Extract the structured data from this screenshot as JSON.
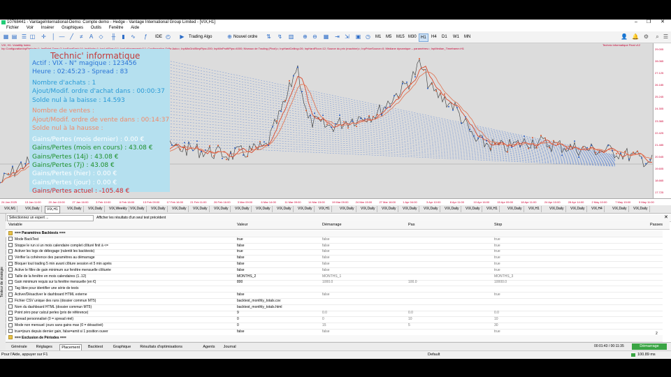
{
  "window": {
    "title": "10768441 - VantageInternational-Demo: Compte demo - Hedge - Vantage International Group Limited - [VIX,H1]",
    "minimize": "–",
    "restore": "❐",
    "close": "✕"
  },
  "menu": [
    "Fichier",
    "Voir",
    "Insérer",
    "Graphiques",
    "Outils",
    "Fenêtre",
    "Aide"
  ],
  "toolbar": {
    "ide": "IDE",
    "algo": "Trading Algo",
    "new_order": "Nouvel ordre",
    "timeframes": [
      "M1",
      "M5",
      "M15",
      "M30",
      "H1",
      "H4",
      "D1",
      "W1",
      "MN"
    ],
    "selected_tf": "H1"
  },
  "chart": {
    "symbol_line": "VIX, H1:  Volatility Index",
    "info_line": "Inp ConfigurationInpPeriode=1; InpPoint Zone=2; InpEmaFast=14; InpMode=1; InpLotSize=0.1; InpLotIncrement=0.1; Configuration Grille Auto=; InpMinGridStepPips=200; InpMinProfitPips=4000; Niveaux de Trading (Pivot)=; InpHardCeiling=26; InpHardFloor=12; Source du prix (machine)=; InpPriceSource=0; Médiane dynamique – paramètres=; InpMedian_Timeframe=H1",
    "right_label": "Technic informatique Final v12",
    "price_ticks": [
      "29.005",
      "28.065",
      "27.125",
      "26.185",
      "25.245",
      "24.305",
      "23.365",
      "22.425",
      "21.485",
      "20.545",
      "19.605",
      "18.665",
      "17.725"
    ],
    "date_ticks": [
      "24 Jan 2025",
      "13 Jan 11:00",
      "20 Jan 10:00",
      "27 Jan 16:00",
      "3 Feb 10:00",
      "6 Feb 16:00",
      "13 Feb 09:00",
      "17 Feb 16:00",
      "21 Feb 11:00",
      "26 Feb 16:00",
      "3 Mar 09:00",
      "6 Mar 14:00",
      "11 Mar 09:00",
      "14 Mar 15:00",
      "19 Mar 09:00",
      "24 Mar 15:00",
      "27 Mar 16:00",
      "1 Apr 04:00",
      "3 Apr 10:00",
      "8 Apr 11:00",
      "10 Apr 16:00",
      "15 Apr 09:00",
      "18 Apr 11:00",
      "24 Apr 10:00",
      "28 Apr 14:00",
      "2 May 10:00",
      "7 May 15:00",
      "9 May 11:00"
    ]
  },
  "panel": {
    "title": "Technic' informatique",
    "lines": [
      {
        "text": "Actif : VIX - N° magique : 123456",
        "color": "#2a74d6"
      },
      {
        "text": "Heure : 02:45:23 - Spread : 83",
        "color": "#2a74d6"
      },
      {
        "text": "Nombre d'achats : 1",
        "color": "#2a9ad6"
      },
      {
        "text": "Ajout/Modif. ordre d'achat dans : 00:00:37",
        "color": "#2a9ad6"
      },
      {
        "text": "Solde nul à la baisse : 14.593",
        "color": "#2a9ad6"
      },
      {
        "text": "Nombre de ventes :",
        "color": "#f08a6a"
      },
      {
        "text": "Ajout/Modif. ordre de vente dans : 00:14:37",
        "color": "#f08a6a"
      },
      {
        "text": "Solde nul à la hausse :",
        "color": "#f08a6a"
      },
      {
        "text": "Gains/Pertes (mois dernier) : 0.00 €",
        "color": "#ffffff"
      },
      {
        "text": "Gains/Pertes (mois en cours) : 43.08 €",
        "color": "#1d8f2a"
      },
      {
        "text": "Gains/Pertes (14j) : 43.08 €",
        "color": "#1d8f2a"
      },
      {
        "text": "Gains/Pertes (7j) : 43.08 €",
        "color": "#1d8f2a"
      },
      {
        "text": "Gains/Pertes (hier) : 0.00 €",
        "color": "#ffffff"
      },
      {
        "text": "Gains/Pertes (jour) : 0.00 €",
        "color": "#ffffff"
      },
      {
        "text": "Gains/Pertes actuel : -105.48 €",
        "color": "#d8262a"
      }
    ]
  },
  "chart_tabs": [
    "VIX,M1",
    "VIX,Daily",
    "VIX,H1",
    "VIX,Daily",
    "VIX,Daily",
    "VIX,Weekly",
    "VIX,Daily",
    "VIX,Daily",
    "VIX,Daily",
    "VIX,Daily",
    "VIX,Daily",
    "VIX,Daily",
    "VIX,Daily",
    "VIX,Daily",
    "VIX,Daily",
    "VIX,H1",
    "VIX,Daily",
    "VIX,Daily",
    "VIX,Daily",
    "VIX,Daily",
    "VIX,Daily",
    "VIX,Daily",
    "VIX,Daily",
    "VIX,H1",
    "VIX,Daily",
    "VIX,H1",
    "VIX,Daily",
    "VIX,Daily",
    "VIX,H4",
    "VIX,Daily",
    "VIX,Daily"
  ],
  "active_chart_tab": 2,
  "tester": {
    "select_expert": "Sélectionnez un expert ...",
    "show_results": "Afficher les résultats d'un seul test précédent",
    "side_label": "Testeur de stratégie",
    "headers": {
      "variable": "Variable",
      "valeur": "Valeur",
      "demarrage": "Démarrage",
      "pas": "Pas",
      "stop": "Stop",
      "passes": "Passes"
    },
    "rows": [
      {
        "name": "=== Paramètres Backtests ===",
        "section": true,
        "valeur": "",
        "demarrage": "",
        "pas": "",
        "stop": ""
      },
      {
        "name": "Mode BackTest",
        "valeur": "true",
        "demarrage": "false",
        "pas": "",
        "stop": "true"
      },
      {
        "name": "Stoppe le run si un mois calendaire complet clôturé finit à <=",
        "valeur": "false",
        "demarrage": "false",
        "pas": "",
        "stop": "true"
      },
      {
        "name": "Activer les logs de débogage (ralentit les backtests)",
        "valeur": "true",
        "demarrage": "false",
        "pas": "",
        "stop": "true"
      },
      {
        "name": "Vérifier la cohérence des paramètres au démarrage",
        "valeur": "false",
        "demarrage": "false",
        "pas": "",
        "stop": "true"
      },
      {
        "name": "Bloquer tout trading 5 min avant clôture session et 5 min après",
        "valeur": "false",
        "demarrage": "false",
        "pas": "",
        "stop": "true"
      },
      {
        "name": "Active le filtre de gain minimum sur fenêtre mensuelle clôturée",
        "valeur": "false",
        "demarrage": "false",
        "pas": "",
        "stop": "true"
      },
      {
        "name": "Taille de la fenêtre en mois calendaires (1..12)",
        "valeur": "MONTHS_2",
        "demarrage": "MONTHS_1",
        "pas": "",
        "stop": "MONTHS_3"
      },
      {
        "name": "Gain minimum requis sur la fenêtre mensuelle (en €)",
        "valeur": "800",
        "demarrage": "1000.0",
        "pas": "100.0",
        "stop": "10000.0"
      },
      {
        "name": "Tag libre pour identifier une série de tests",
        "valeur": "",
        "demarrage": "",
        "pas": "",
        "stop": ""
      },
      {
        "name": "Activer/Désactiver le dashboard HTML externe",
        "valeur": "false",
        "demarrage": "false",
        "pas": "",
        "stop": "true"
      },
      {
        "name": "Fichier CSV unique des runs (dossier commun MT5)",
        "valeur": "backtest_monthly_totals.csv",
        "demarrage": "",
        "pas": "",
        "stop": ""
      },
      {
        "name": "Nom du dashboard HTML (dossier commun MT5)",
        "valeur": "backtest_monthly_totals.html",
        "demarrage": "",
        "pas": "",
        "stop": ""
      },
      {
        "name": "Point zéro pour calcul perles (prix de référence)",
        "valeur": "9",
        "demarrage": "0.0",
        "pas": "0.0",
        "stop": "0.0"
      },
      {
        "name": "Spread personnalisé (0 = spread réel)",
        "valeur": "0",
        "demarrage": "0",
        "pas": "10",
        "stop": "10"
      },
      {
        "name": "Mode non mensuel: jours sans gains max (0 = désactivé)",
        "valeur": "0",
        "demarrage": "15",
        "pas": "5",
        "stop": "30"
      },
      {
        "name": "true=jours depuis dernier gain, false=amit si 1 position ouver",
        "valeur": "false",
        "demarrage": "false",
        "pas": "",
        "stop": "true"
      },
      {
        "name": "=== Exclusion de Périodes ===",
        "section": true,
        "valeur": "",
        "demarrage": "",
        "pas": "",
        "stop": ""
      }
    ],
    "passes_value": "2",
    "bottom_tabs": [
      "Générale",
      "Réglages",
      "Placement",
      "Backtest",
      "Graphique",
      "Résultats d'optimisations",
      "Agents",
      "Journal"
    ],
    "active_bottom_tab": 2,
    "timer": "00:01:43 / 00:11:35",
    "start_button": "Démarrage"
  },
  "status": {
    "help": "Pour l'Aide, appuyer sur F1",
    "profile": "Default",
    "ping": "100.89 ms"
  }
}
